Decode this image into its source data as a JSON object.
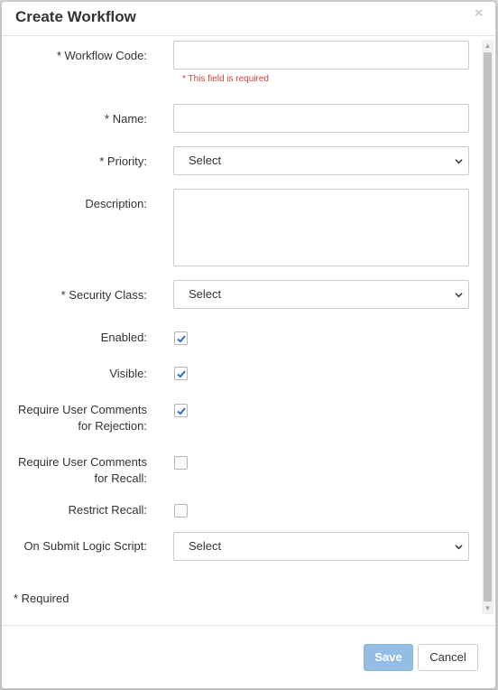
{
  "dialog": {
    "title": "Create Workflow",
    "close_glyph": "×"
  },
  "form": {
    "workflow_code": {
      "label": "* Workflow Code:",
      "value": "",
      "error": "* This field is required"
    },
    "name": {
      "label": "* Name:",
      "value": ""
    },
    "priority": {
      "label": "* Priority:",
      "selected": "Select"
    },
    "description": {
      "label": "Description:",
      "value": ""
    },
    "security_class": {
      "label": "* Security Class:",
      "selected": "Select"
    },
    "enabled": {
      "label": "Enabled:",
      "checked": true
    },
    "visible": {
      "label": "Visible:",
      "checked": true
    },
    "require_comments_rejection": {
      "label_line1": "Require User Comments",
      "label_line2": "for Rejection:",
      "checked": true
    },
    "require_comments_recall": {
      "label_line1": "Require User Comments",
      "label_line2": "for Recall:",
      "checked": false
    },
    "restrict_recall": {
      "label": "Restrict Recall:",
      "checked": false
    },
    "on_submit_logic_script": {
      "label": "On Submit Logic Script:",
      "selected": "Select"
    },
    "required_note": "* Required"
  },
  "footer": {
    "save_label": "Save",
    "cancel_label": "Cancel"
  },
  "colors": {
    "error": "#d43f3a",
    "primary_disabled": "#93bde4",
    "checkmark": "#2a6ebb"
  }
}
